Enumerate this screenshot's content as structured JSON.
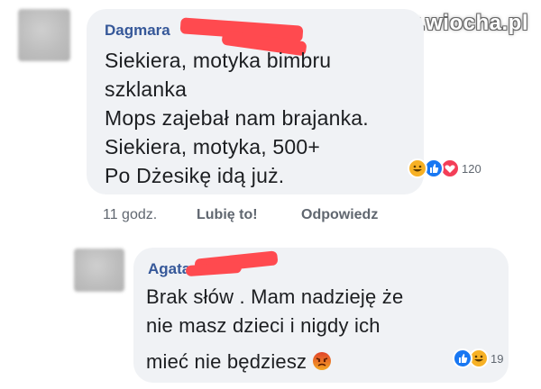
{
  "watermark": "www.wiocha.pl",
  "comment1": {
    "author": "Dagmara",
    "lines": [
      "Siekiera, motyka bimbru",
      "szklanka",
      "Mops zajebał nam brajanka.",
      "Siekiera, motyka, 500+",
      "Po Dżesikę idą już."
    ],
    "reactions": [
      "haha-icon",
      "like-icon",
      "love-icon"
    ],
    "reaction_count": "120",
    "time": "11 godz.",
    "like_label": "Lubię to!",
    "reply_label": "Odpowiedz"
  },
  "comment2": {
    "author": "Agata",
    "lines": [
      "Brak słów . Mam nadzieję że",
      "nie masz dzieci i nigdy ich",
      "mieć nie będziesz"
    ],
    "emoji": "angry-emoji",
    "reactions": [
      "like-icon",
      "haha-icon"
    ],
    "reaction_count": "19"
  },
  "colors": {
    "author": "#365899",
    "bubble": "#f0f2f5",
    "redaction": "#ff4a4f",
    "like": "#1877f2",
    "love": "#f33e58",
    "haha": "#f7b125"
  }
}
